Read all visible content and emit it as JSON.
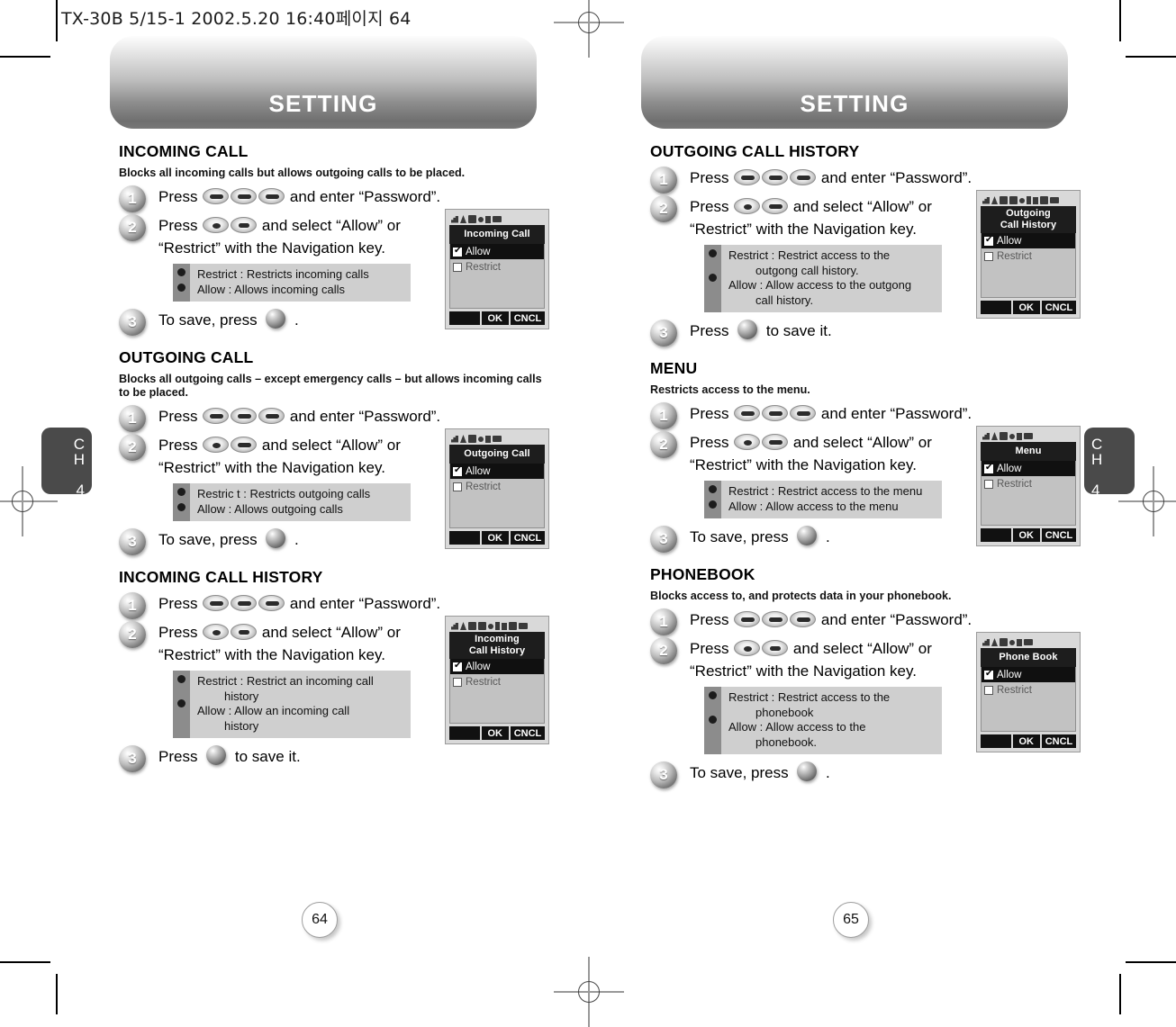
{
  "file_header": "TX-30B 5/15-1  2002.5.20 16:40페이지 64",
  "chapter_tab": {
    "ch": "C",
    "h": "H",
    "num": "4"
  },
  "left_page": {
    "banner_title": "SETTING",
    "page_number": "64",
    "sections": [
      {
        "title": "INCOMING CALL",
        "desc": "Blocks all incoming calls but allows outgoing calls to be placed.",
        "steps": [
          {
            "num": "1",
            "text_before": "Press",
            "keys": [
              "key-send",
              "key-star",
              "key-pound"
            ],
            "text_after": "and enter “Password”."
          },
          {
            "num": "2",
            "text_before": "Press",
            "keys": [
              "key-nav",
              "key-num2"
            ],
            "text_after": "and select “Allow” or “Restrict” with the Navigation key."
          },
          {
            "num": "3",
            "text_before": "To save, press",
            "keys": [],
            "text_after": "."
          }
        ],
        "note": [
          {
            "text": "Restrict : Restricts incoming calls",
            "indent": false
          },
          {
            "text": "Allow : Allows incoming calls",
            "indent": false
          }
        ],
        "screen": {
          "title_lines": [
            "Incoming Call"
          ],
          "options": [
            {
              "label": "Allow",
              "checked": true,
              "selected": true
            },
            {
              "label": "Restrict",
              "checked": false,
              "selected": false
            }
          ],
          "softkeys": {
            "left": "",
            "center": "OK",
            "right": "CNCL"
          }
        }
      },
      {
        "title": "OUTGOING CALL",
        "desc": "Blocks all outgoing calls – except emergency calls – but allows incoming calls to be placed.",
        "steps": [
          {
            "num": "1",
            "text_before": "Press",
            "keys": [
              "key-send",
              "key-star",
              "key-pound"
            ],
            "text_after": "and enter “Password”."
          },
          {
            "num": "2",
            "text_before": "Press",
            "keys": [
              "key-nav",
              "key-pound"
            ],
            "text_after": "and select “Allow” or “Restrict” with the Navigation key."
          },
          {
            "num": "3",
            "text_before": "To save, press",
            "keys": [],
            "text_after": "."
          }
        ],
        "note": [
          {
            "text": "Restric t : Restricts outgoing calls",
            "indent": false
          },
          {
            "text": "Allow : Allows outgoing calls",
            "indent": false
          }
        ],
        "screen": {
          "title_lines": [
            "Outgoing Call"
          ],
          "options": [
            {
              "label": "Allow",
              "checked": true,
              "selected": true
            },
            {
              "label": "Restrict",
              "checked": false,
              "selected": false
            }
          ],
          "softkeys": {
            "left": "",
            "center": "OK",
            "right": "CNCL"
          }
        }
      },
      {
        "title": "INCOMING CALL HISTORY",
        "desc": "",
        "steps": [
          {
            "num": "1",
            "text_before": "Press",
            "keys": [
              "key-send",
              "key-star",
              "key-pound"
            ],
            "text_after": "and enter “Password”."
          },
          {
            "num": "2",
            "text_before": "Press",
            "keys": [
              "key-nav",
              "key-num4"
            ],
            "text_after": "and select “Allow” or “Restrict” with the Navigation key."
          },
          {
            "num": "3",
            "text_before": "Press",
            "keys": [],
            "text_after": "to save it."
          }
        ],
        "note": [
          {
            "text": "Restrict : Restrict an incoming call",
            "indent": false
          },
          {
            "text": "history",
            "indent": true
          },
          {
            "text": "Allow : Allow an incoming call",
            "indent": false
          },
          {
            "text": "history",
            "indent": true
          }
        ],
        "screen": {
          "title_lines": [
            "Incoming",
            "Call History"
          ],
          "options": [
            {
              "label": "Allow",
              "checked": true,
              "selected": true
            },
            {
              "label": "Restrict",
              "checked": false,
              "selected": false
            }
          ],
          "softkeys": {
            "left": "",
            "center": "OK",
            "right": "CNCL"
          }
        }
      }
    ]
  },
  "right_page": {
    "banner_title": "SETTING",
    "page_number": "65",
    "sections": [
      {
        "title": "OUTGOING CALL HISTORY",
        "desc": "",
        "steps": [
          {
            "num": "1",
            "text_before": "Press",
            "keys": [
              "key-send",
              "key-star",
              "key-pound"
            ],
            "text_after": "and enter “Password”."
          },
          {
            "num": "2",
            "text_before": "Press",
            "keys": [
              "key-nav",
              "key-star"
            ],
            "text_after": "and select “Allow” or “Restrict” with the Navigation key."
          },
          {
            "num": "3",
            "text_before": "Press",
            "keys": [],
            "text_after": "to save it."
          }
        ],
        "note": [
          {
            "text": "Restrict : Restrict access to the",
            "indent": false
          },
          {
            "text": "outgong call history.",
            "indent": true
          },
          {
            "text": "Allow : Allow access to the outgong",
            "indent": false
          },
          {
            "text": "call history.",
            "indent": true
          }
        ],
        "screen": {
          "title_lines": [
            "Outgoing",
            "Call History"
          ],
          "options": [
            {
              "label": "Allow",
              "checked": true,
              "selected": true
            },
            {
              "label": "Restrict",
              "checked": false,
              "selected": false
            }
          ],
          "softkeys": {
            "left": "",
            "center": "OK",
            "right": "CNCL"
          }
        }
      },
      {
        "title": "MENU",
        "desc": "Restricts access to the menu.",
        "steps": [
          {
            "num": "1",
            "text_before": "Press",
            "keys": [
              "key-send",
              "key-star",
              "key-pound"
            ],
            "text_after": "and enter “Password”."
          },
          {
            "num": "2",
            "text_before": "Press",
            "keys": [
              "key-nav",
              "key-pound"
            ],
            "text_after": "and select “Allow” or “Restrict” with the Navigation key."
          },
          {
            "num": "3",
            "text_before": "To save, press",
            "keys": [],
            "text_after": "."
          }
        ],
        "note": [
          {
            "text": "Restrict : Restrict access to the menu",
            "indent": false
          },
          {
            "text": "Allow : Allow access to the menu",
            "indent": false
          }
        ],
        "screen": {
          "title_lines": [
            "Menu"
          ],
          "options": [
            {
              "label": "Allow",
              "checked": true,
              "selected": true
            },
            {
              "label": "Restrict",
              "checked": false,
              "selected": false
            }
          ],
          "softkeys": {
            "left": "",
            "center": "OK",
            "right": "CNCL"
          }
        }
      },
      {
        "title": "PHONEBOOK",
        "desc": "Blocks access to, and protects data in your phonebook.",
        "steps": [
          {
            "num": "1",
            "text_before": "Press",
            "keys": [
              "key-send",
              "key-star",
              "key-pound"
            ],
            "text_after": "and enter “Password”."
          },
          {
            "num": "2",
            "text_before": "Press",
            "keys": [
              "key-nav",
              "key-num7"
            ],
            "text_after": "and select “Allow” or “Restrict” with the Navigation key."
          },
          {
            "num": "3",
            "text_before": "To save, press",
            "keys": [],
            "text_after": "."
          }
        ],
        "note": [
          {
            "text": "Restrict : Restrict access to the",
            "indent": false
          },
          {
            "text": "phonebook",
            "indent": true
          },
          {
            "text": "Allow : Allow access to the",
            "indent": false
          },
          {
            "text": "phonebook.",
            "indent": true
          }
        ],
        "screen": {
          "title_lines": [
            "Phone Book"
          ],
          "options": [
            {
              "label": "Allow",
              "checked": true,
              "selected": true
            },
            {
              "label": "Restrict",
              "checked": false,
              "selected": false
            }
          ],
          "softkeys": {
            "left": "",
            "center": "OK",
            "right": "CNCL"
          }
        }
      }
    ]
  },
  "colors": {
    "banner_dark": "#6f6f6f",
    "tab_gray": "#4a4a4a",
    "note_bg": "#cfcfcf",
    "note_stripe": "#8c8c8c",
    "screen_title_bg": "#1d1d1d",
    "screen_body_bg": "#c2c2c2"
  }
}
